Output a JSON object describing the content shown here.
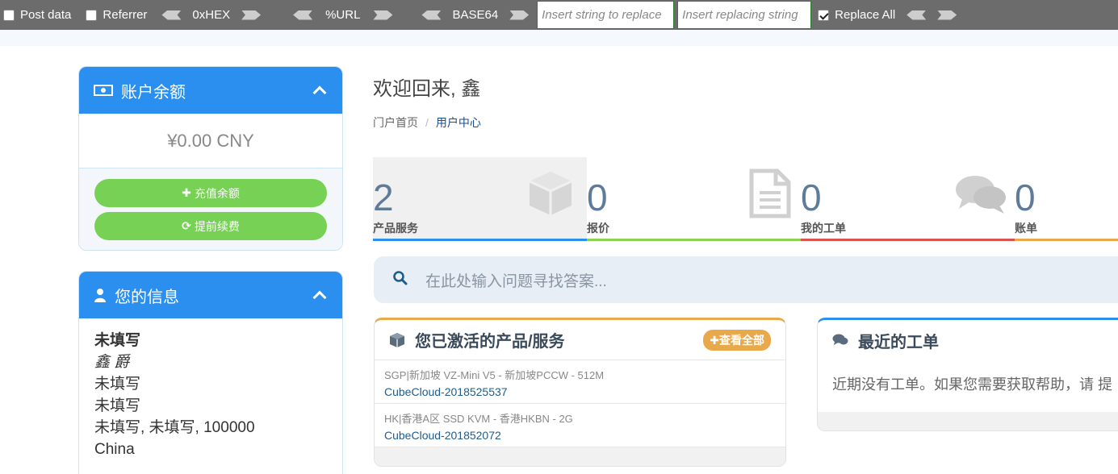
{
  "toolbar": {
    "post_data": "Post data",
    "referrer": "Referrer",
    "hex": "0xHEX",
    "url": "%URL",
    "base64": "BASE64",
    "replace_placeholder": "Insert string to replace",
    "replacing_placeholder": "Insert replacing string",
    "replace_all": "Replace All",
    "replace_all_checked": true
  },
  "balance_panel": {
    "title": "账户余额",
    "amount": "¥0.00 CNY",
    "recharge": "充值余额",
    "renew": "提前续费"
  },
  "info_panel": {
    "title": "您的信息",
    "lines": [
      "未填写",
      "鑫 爵",
      "未填写",
      "未填写",
      "未填写, 未填写, 100000",
      "China"
    ]
  },
  "welcome": "欢迎回来, 鑫",
  "breadcrumb": {
    "home": "门户首页",
    "current": "用户中心"
  },
  "stats": [
    {
      "value": "2",
      "label": "产品服务",
      "color": "#2b8ff0"
    },
    {
      "value": "0",
      "label": "报价",
      "color": "#8cd150"
    },
    {
      "value": "0",
      "label": "我的工单",
      "color": "#d9534f"
    },
    {
      "value": "0",
      "label": "账单",
      "color": "#e9a84a"
    }
  ],
  "search": {
    "placeholder": "在此处输入问题寻找答案..."
  },
  "products": {
    "title": "您已激活的产品/服务",
    "view_all": "查看全部",
    "items": [
      {
        "name": "SGP|新加坡 VZ-Mini V5 - 新加坡PCCW - 512M",
        "label": "CubeCloud-2018525537"
      },
      {
        "name": "HK|香港A区 SSD KVM - 香港HKBN - 2G",
        "label": "CubeCloud-201852072"
      }
    ]
  },
  "tickets": {
    "title": "最近的工单",
    "empty": "近期没有工单。如果您需要获取帮助，请 提"
  }
}
